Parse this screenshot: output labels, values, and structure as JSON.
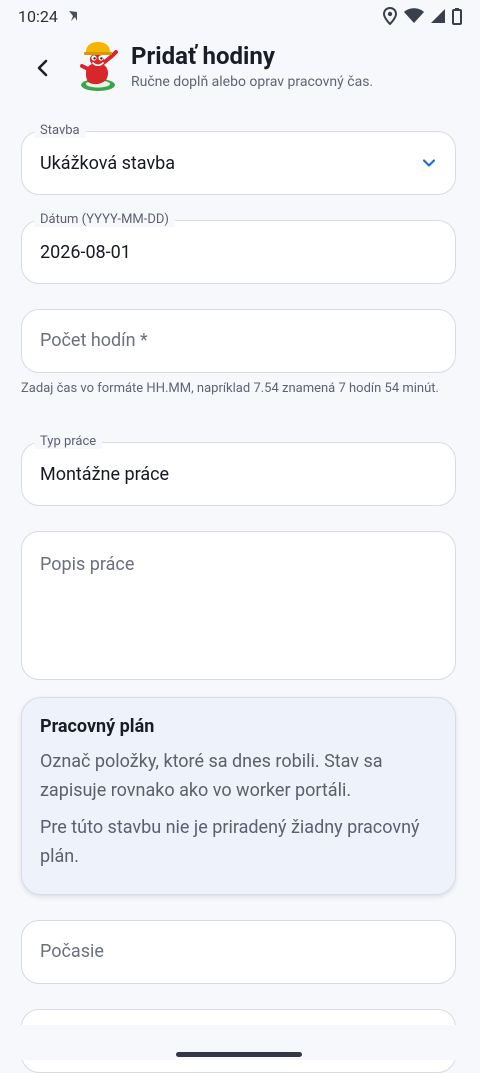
{
  "status": {
    "time": "10:24"
  },
  "header": {
    "back_icon": "back-chevron-icon",
    "title": "Pridať hodiny",
    "subtitle": "Ručne doplň alebo oprav pracovný čas."
  },
  "form": {
    "stavba": {
      "label": "Stavba",
      "value": "Ukážková stavba"
    },
    "datum": {
      "label": "Dátum (YYYY-MM-DD)",
      "value": "2026-08-01"
    },
    "pocet_hodin": {
      "placeholder": "Počet hodín *",
      "helper": "Zadaj čas vo formáte HH.MM, napríklad 7.54 znamená 7 hodín 54 minút."
    },
    "typ_prace": {
      "label": "Typ práce",
      "value": "Montážne práce"
    },
    "popis_prace": {
      "placeholder": "Popis práce"
    },
    "pracovny_plan": {
      "title": "Pracovný plán",
      "text1": "Označ položky, ktoré sa dnes robili. Stav sa zapisuje rovnako ako vo worker portáli.",
      "text2": "Pre túto stavbu nie je priradený žiadny pracovný plán."
    },
    "pocasie": {
      "placeholder": "Počasie"
    }
  },
  "colors": {
    "accent": "#1f6fd1",
    "background": "#f7f8fc"
  }
}
